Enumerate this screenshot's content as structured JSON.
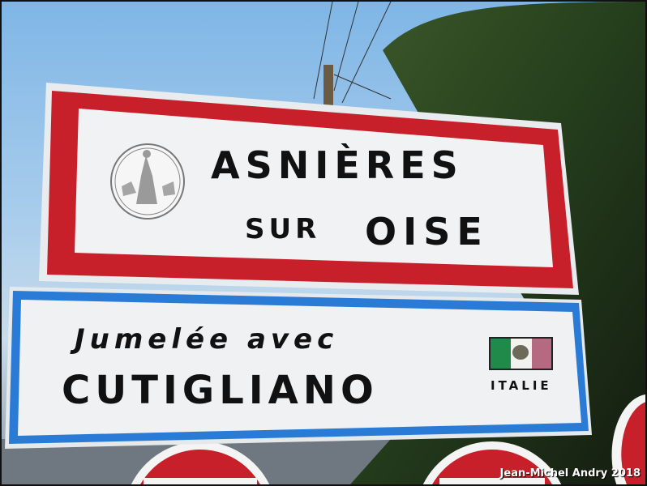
{
  "town_sign": {
    "line1": "ASNIÈRES",
    "line2a": "SUR",
    "line2b": "OISE",
    "border_color": "#c8202a",
    "seal_icon": "town-coat-of-arms-seal"
  },
  "twin_sign": {
    "line1": "Jumelée avec",
    "line2": "CUTIGLIANO",
    "country": "ITALIE",
    "border_color": "#2a7bd6",
    "flag_icon": "italian-flag",
    "flag_colors": [
      "#1f8a4a",
      "#f2f2ee",
      "#b56a82"
    ]
  },
  "watermark": "Jean-Michel Andry 2018"
}
